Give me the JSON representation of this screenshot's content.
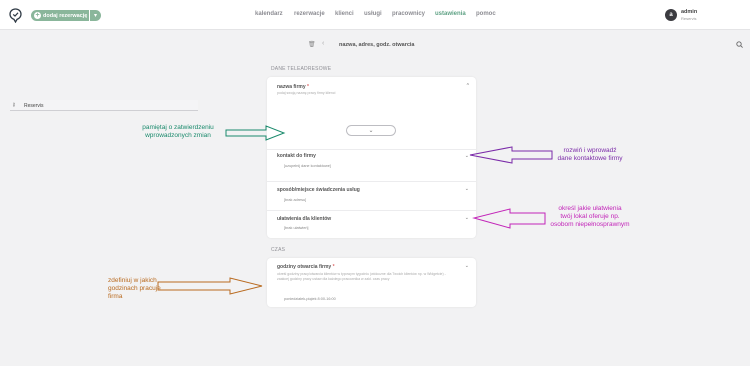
{
  "header": {
    "add_button_label": "dodaj rezerwację",
    "nav": [
      {
        "label": "kalendarz",
        "active": false
      },
      {
        "label": "rezerwacje",
        "active": false
      },
      {
        "label": "klienci",
        "active": false
      },
      {
        "label": "usługi",
        "active": false
      },
      {
        "label": "pracownicy",
        "active": false
      },
      {
        "label": "ustawienia",
        "active": true
      },
      {
        "label": "pomoc",
        "active": false
      }
    ],
    "user": {
      "initial": "a",
      "name": "admin",
      "subtitle": "Reservis"
    }
  },
  "subheader": {
    "title": "nazwa, adres, godz. otwarcia"
  },
  "sections": {
    "contact": {
      "label": "DANE TELEADRESOWE",
      "company_name": {
        "title": "nazwa firmy",
        "required_mark": "*",
        "description": "podaj swoją nazwę pracy firmy klienci",
        "value": "Reservis"
      },
      "contact_row": {
        "title": "kontakt do firmy",
        "value": "[uzupełnij dane kontaktowe]"
      },
      "place_row": {
        "title": "sposób/miejsce świadczenia usług",
        "value": "[brak adresu]"
      },
      "facilities_row": {
        "title": "ułatwienia dla klientów",
        "value": "[brak ułatwień]"
      }
    },
    "time": {
      "label": "CZAS",
      "hours": {
        "title": "godziny otwarcia firmy",
        "required_mark": "*",
        "description": "określ godziny pracy/otwarcia klientów w typowym tygodniu (widoczne dla Twoich klientów np. w Widgetcie) - zaakcej godziny pracy ustaw dla każdego pracownika w zakł. czas pracy",
        "value": "poniedziałek-piątek 8:00-16:00"
      }
    }
  },
  "annotations": {
    "save_reminder": [
      "pamiętaj o zatwierdzeniu",
      "wprowadzonych zmian"
    ],
    "contact_hint": [
      "rozwiń i wprowadź",
      "dane kontaktowe firmy"
    ],
    "facilities_hint": [
      "określ jakie ułatwienia",
      "twój lokal oferuje np.",
      "osobom niepełnosprawnym"
    ],
    "hours_hint": [
      "zdefiniuj w jakich",
      "godzinach pracuje",
      "firma"
    ]
  },
  "colors": {
    "accent": "#5ea184",
    "button": "#8ab69b",
    "annotation_green": "#1a8a6c",
    "annotation_purple": "#7a2aa8",
    "annotation_magenta": "#c224b8",
    "annotation_orange": "#b96a1f"
  },
  "icons": [
    "logo-icon",
    "plus-icon",
    "caret-down-icon",
    "trash-icon",
    "chevron-left-icon",
    "search-icon",
    "key-icon",
    "chevron-up-icon",
    "chevron-down-icon"
  ]
}
